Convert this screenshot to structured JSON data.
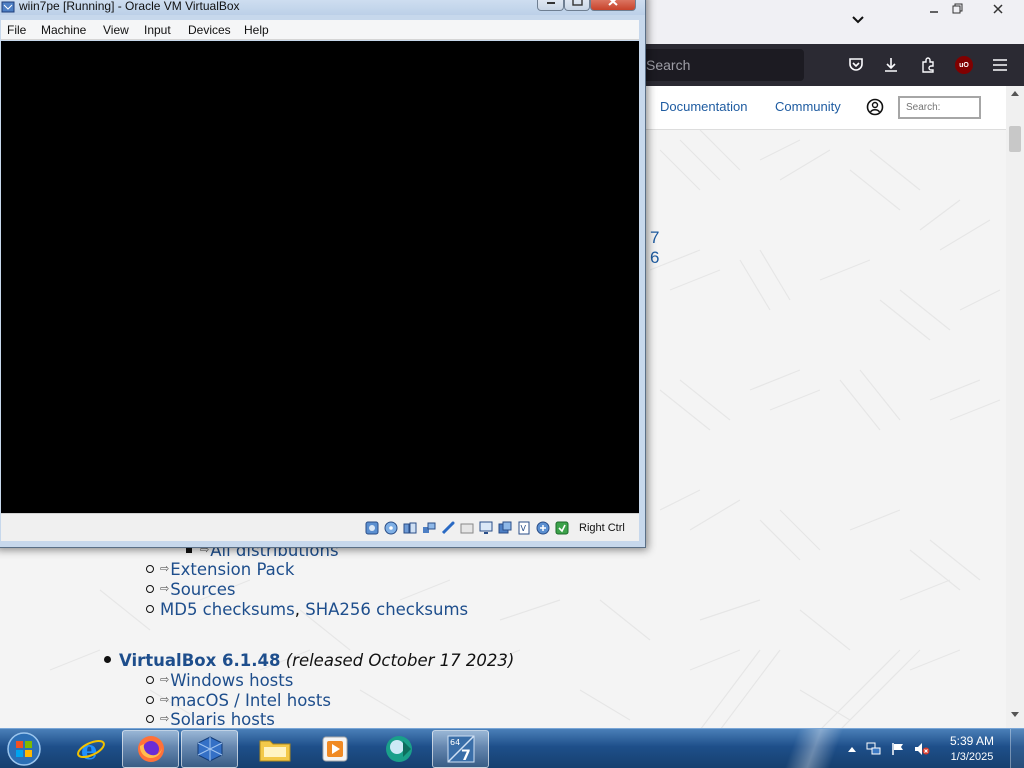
{
  "browser": {
    "toolbar": {
      "search_placeholder": "Search"
    },
    "site_nav": {
      "documentation": "Documentation",
      "community": "Community",
      "search_placeholder": "Search:"
    },
    "partial_text": [
      "7",
      "6"
    ],
    "downloads": {
      "all_distributions": "All distributions",
      "extension_pack": "Extension Pack",
      "sources": "Sources",
      "md5": "MD5 checksums",
      "comma": ",",
      "sha256": "SHA256 checksums",
      "release_name": "VirtualBox 6.1.48",
      "release_note": "(released October 17 2023)",
      "windows_hosts": "Windows hosts",
      "macos_hosts": "macOS / Intel hosts",
      "solaris_hosts": "Solaris hosts"
    },
    "ext_link_glyph": "⇨"
  },
  "vbox": {
    "title": "wiin7pe [Running] - Oracle VM VirtualBox",
    "menu": [
      "File",
      "Machine",
      "View",
      "Input",
      "Devices",
      "Help"
    ],
    "host_key": "Right Ctrl"
  },
  "taskbar": {
    "time": "5:39 AM",
    "date": "1/3/2025",
    "vm_badge": "64",
    "vm_badge_num": "7"
  },
  "colors": {
    "link": "#1e4e8c",
    "firefox_toolbar": "#2b2a33",
    "ublock": "#800000",
    "taskbar": "#1e4f8a"
  }
}
